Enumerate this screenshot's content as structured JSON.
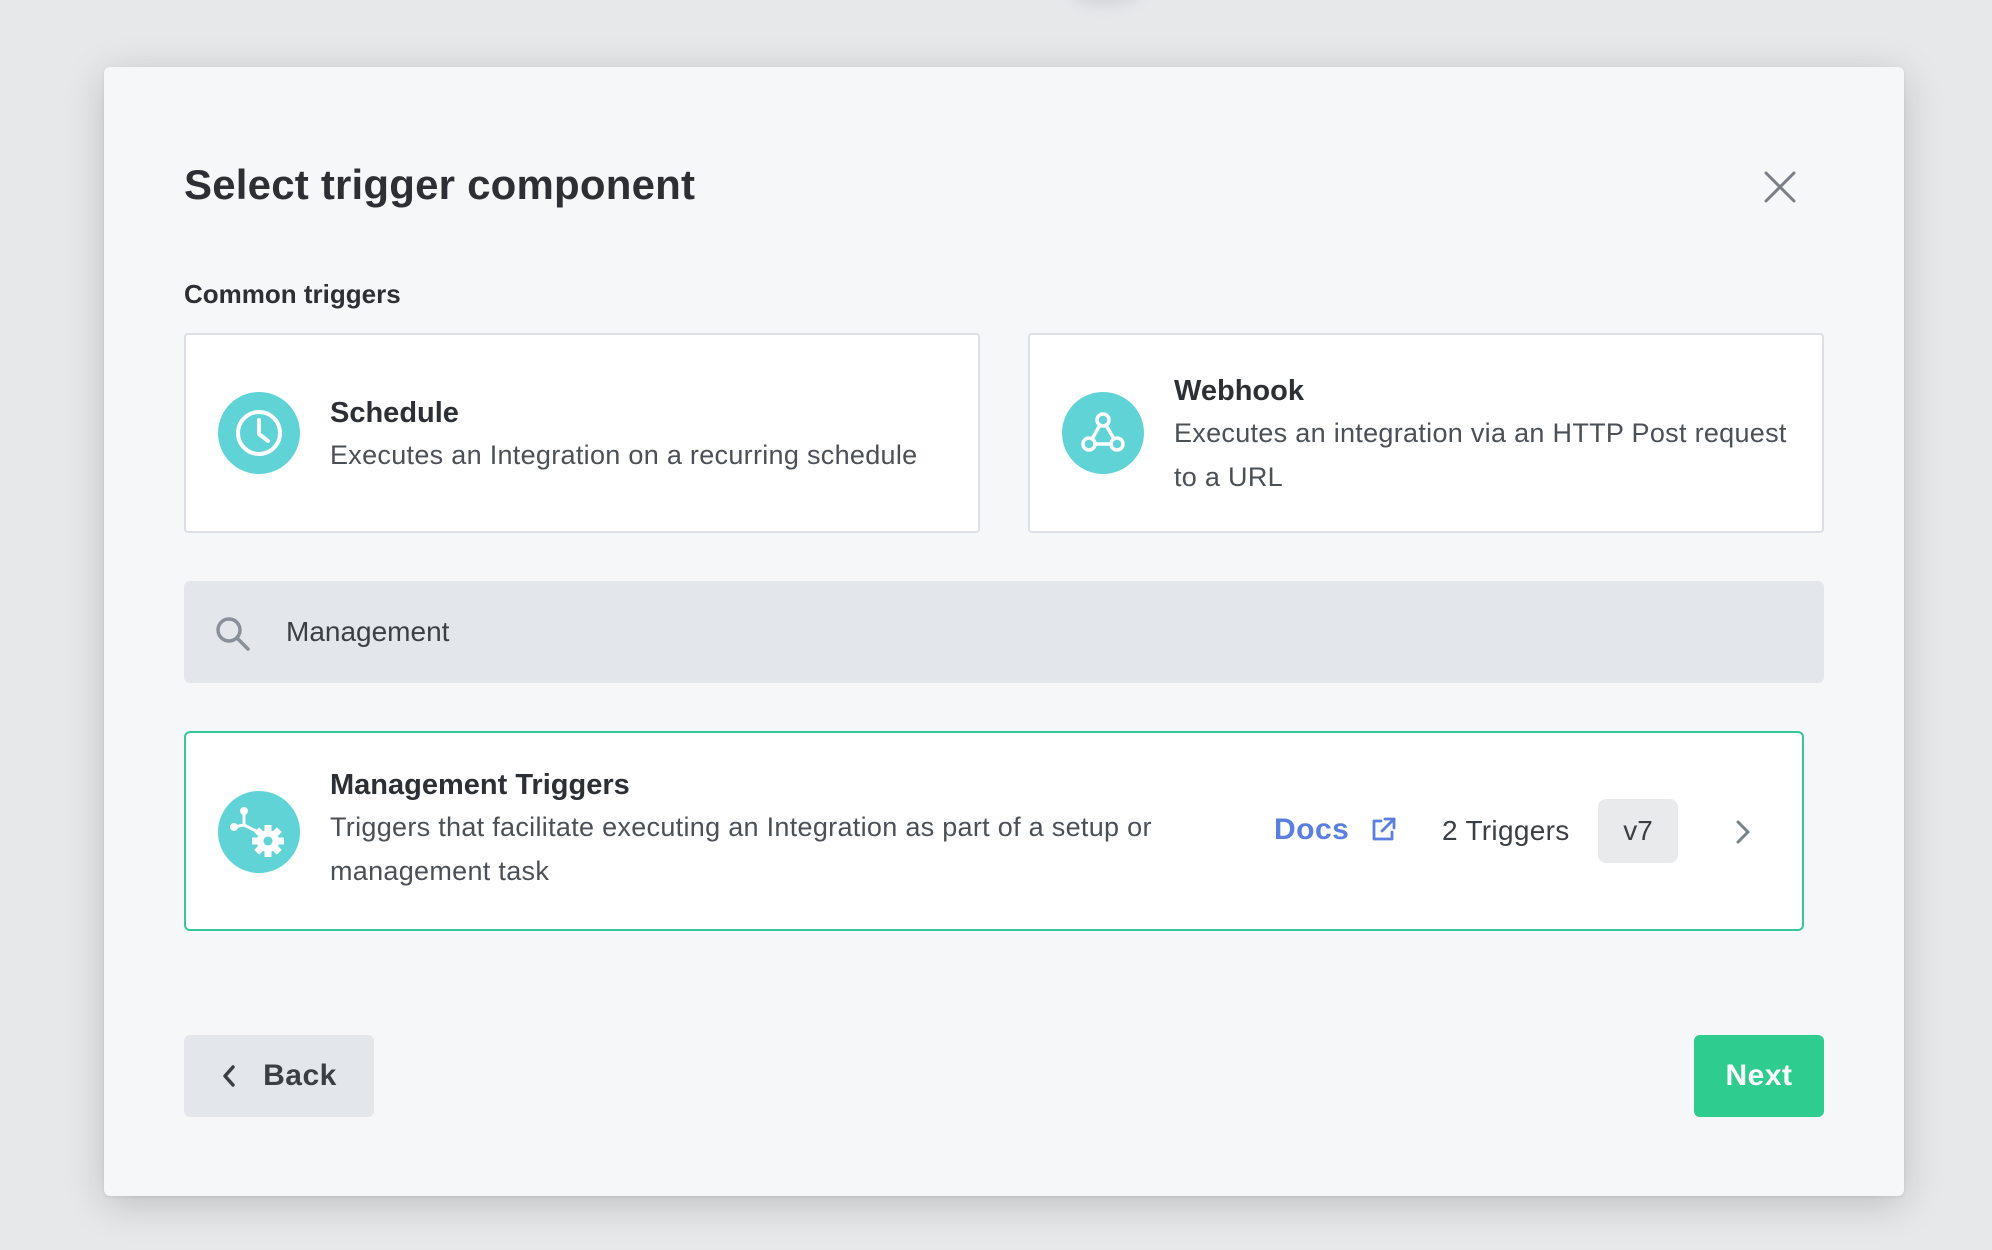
{
  "modal": {
    "title": "Select trigger component",
    "close_icon": "close-icon"
  },
  "common_triggers": {
    "label": "Common triggers",
    "items": [
      {
        "title": "Schedule",
        "description": "Executes an Integration on a recurring schedule",
        "icon": "clock-icon"
      },
      {
        "title": "Webhook",
        "description": "Executes an integration via an HTTP Post request to a URL",
        "icon": "webhook-icon"
      }
    ]
  },
  "search": {
    "value": "Management",
    "icon": "search-icon"
  },
  "results": [
    {
      "title": "Management Triggers",
      "description": "Triggers that facilitate executing an Integration as part of a setup or management task",
      "icon": "management-gear-icon",
      "docs_label": "Docs",
      "trigger_count": "2 Triggers",
      "version": "v7"
    }
  ],
  "footer": {
    "back_label": "Back",
    "next_label": "Next"
  },
  "colors": {
    "accent_green": "#2ecc8e",
    "selected_border": "#35c79a",
    "icon_teal": "#5fd3d6",
    "link_blue": "#5b7fe0"
  }
}
